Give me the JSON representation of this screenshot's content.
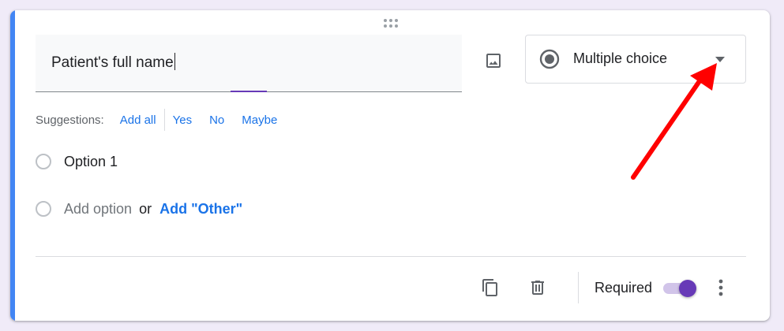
{
  "question": {
    "title_value": "Patient's full name",
    "type_selected": "Multiple choice"
  },
  "suggestions": {
    "label": "Suggestions:",
    "items": [
      "Add all",
      "Yes",
      "No",
      "Maybe"
    ]
  },
  "options": {
    "option1_label": "Option 1",
    "add_option_label": "Add option",
    "or_label": "or",
    "add_other_label": "Add \"Other\""
  },
  "footer": {
    "required_label": "Required",
    "required_on": true
  },
  "icons": {
    "drag": "drag-handle-icon",
    "image": "image-icon",
    "type": "radio-button-checked-icon",
    "dropdown": "arrow-drop-down-icon",
    "duplicate": "copy-icon",
    "delete": "trash-icon",
    "more": "more-vert-icon"
  },
  "colors": {
    "accent_bar": "#4285f4",
    "focus_purple": "#673ab7",
    "link_blue": "#1a73e8",
    "page_background": "#f0ebf8",
    "annotation_arrow": "#ff0000"
  }
}
